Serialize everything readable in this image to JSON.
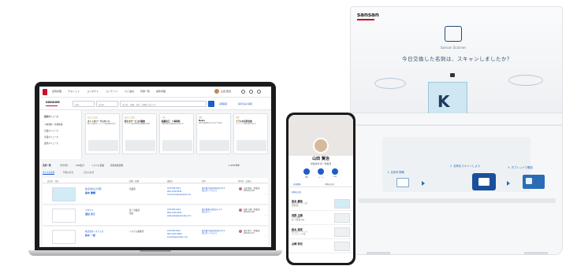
{
  "scanner": {
    "logo": "sansan",
    "mascot_caption": "Sansan Scanner",
    "question": "今日交換した名刺は、スキャンしましたか？",
    "steps": [
      "1. 名刺を準備",
      "2. 名刺をスキャンしよう",
      "3. タブレットで確認"
    ]
  },
  "laptop": {
    "nav": [
      "名刺管理",
      "ウォレット",
      "コンタクト",
      "コンテンツ",
      "人と会社",
      "同僚一覧",
      "案件管理"
    ],
    "user_label": "山田 賢治",
    "logo": "sansan",
    "search_scope": "名刺",
    "search_filter": "会社名",
    "search_placeholder": "会社名、部署、氏名、役職などを入力",
    "search_links": [
      "詳細検索",
      "保存済みの検索"
    ],
    "sidebar": [
      "最新のニュース",
      "人事異動・昇格情報",
      "企業のニュース",
      "企業のニュース",
      "業界のニュース"
    ],
    "news": [
      {
        "tag": "あなたの会社",
        "title": "ホットなワークスタイル",
        "body": "働き方改革のトレンドと最新事例を紹介"
      },
      {
        "tag": "あなたの会社",
        "title": "新たなサービスの開始",
        "body": "クラウド型名刺管理の新機能を発表"
      },
      {
        "tag": "人事",
        "title": "組織改正・人事異動",
        "body": "営業本部の体制変更のお知らせ"
      },
      {
        "tag": "企業",
        "title": "News",
        "body": "業界の最新動向をまとめてお届け"
      },
      {
        "tag": "企業",
        "title": "プラスの名刺交換",
        "body": "オンライン名刺交換が拡大中"
      }
    ],
    "list_bar": [
      "名刺一覧",
      "タグ付け",
      "CSV出力",
      "リストに追加",
      "名刺交換日順"
    ],
    "list_tabs": [
      "すべての名刺",
      "同僚の名刺",
      "自分の名刺"
    ],
    "count": "1,228 件中",
    "headers": [
      "会社名・氏名",
      "部署・役職",
      "連絡先",
      "住所",
      "所有者・交換日"
    ],
    "rows": [
      {
        "company": "株式会社広告代理",
        "name": "森本 慶輔",
        "dept": "営業部",
        "contact": "03-6758-0123\n090-1234-5678\nmorimoto@example.com",
        "address": "東京都渋谷区神宮前5-52-2\n青山オーバルビル",
        "owner": "山田 賢治（営業部）\n2019/11/19"
      },
      {
        "company": "ワタナベ",
        "name": "渡辺 花子",
        "dept": "第一営業部\n部長",
        "contact": "03-6758-0124\n090-1234-5679\nwatanabe@example.com",
        "address": "東京都港区南青山1-2-3\n青山タワー",
        "owner": "佐藤 大輔（営業部）\n2019/11/18"
      },
      {
        "company": "株式会社システムズ",
        "name": "鈴木 一郎",
        "dept": "システム開発部",
        "contact": "03-6758-0125\n090-1234-5680\nsuzuki@example.com",
        "address": "東京都渋谷区神宮前5-52-2\n青山オーバルビル",
        "owner": "田中 陽子（営業部）\n2019/11/17"
      }
    ]
  },
  "phone": {
    "name": "山田 賢治",
    "role": "営業本部 第一営業部",
    "actions": [
      "電話",
      "メール",
      "SNS"
    ],
    "tabs": [
      "名刺情報",
      "同僚の名刺"
    ],
    "section": "同僚の名刺",
    "people": [
      {
        "name": "坂本 慶裕",
        "company": "株式会社アオイ工業\n営業本部"
      },
      {
        "name": "西野 正樹",
        "company": "アオイ商事\n第一営業部 部長"
      },
      {
        "name": "鈴木 美咲",
        "company": "株式会社サイテック\nマーケティング部"
      },
      {
        "name": "山崎 和也",
        "company": ""
      }
    ]
  }
}
